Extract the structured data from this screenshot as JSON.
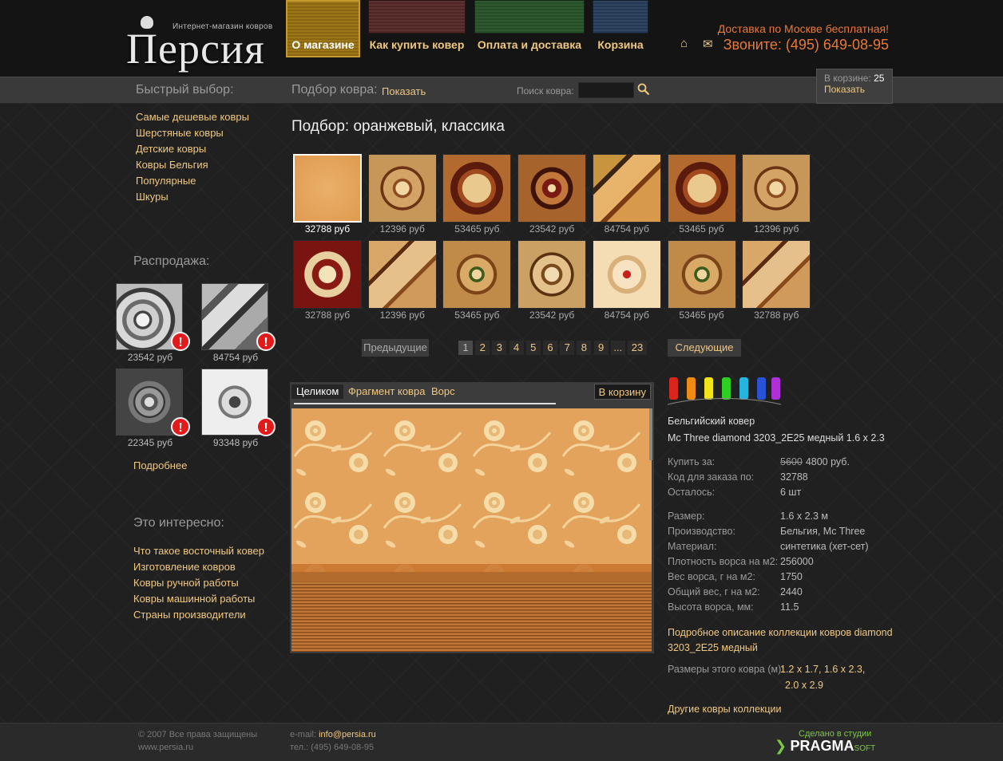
{
  "header": {
    "logo_word": "Персия",
    "logo_tag": "Интернет-магазин ковров",
    "nav": [
      {
        "label": "О магазине",
        "color": "#8a6612"
      },
      {
        "label": "Как купить ковер",
        "color": "#5a2c2c"
      },
      {
        "label": "Оплата и доставка",
        "color": "#2f5a30"
      },
      {
        "label": "Корзина",
        "color": "#2e4460"
      }
    ],
    "home_icon": "⌂",
    "map_icon": "✉",
    "delivery": "Доставка по Москве бесплатная!",
    "phone": "Звоните: (495) 649-08-95"
  },
  "bar": {
    "quick_title": "Быстрый выбор:",
    "selection_title": "Подбор ковра:",
    "selection_link": "Показать",
    "search_label": "Поиск ковра:",
    "search_value": "",
    "cart_label": "В корзине:",
    "cart_count": "25",
    "cart_show": "Показать"
  },
  "quick_links": [
    "Самые дешевые ковры",
    "Шерстяные ковры",
    "Детские ковры",
    "Ковры Бельгия",
    "Популярные",
    "Шкуры"
  ],
  "sale": {
    "title": "Распродажа:",
    "items": [
      {
        "price": "23542 руб"
      },
      {
        "price": "84754 руб"
      },
      {
        "price": "22345 руб"
      },
      {
        "price": "93348 руб"
      }
    ],
    "more": "Подробнее"
  },
  "interest": {
    "title": "Это интересно:",
    "links": [
      "Что такое восточный ковер",
      "Изготовление ковров",
      "Ковры ручной работы",
      "Ковры машинной работы",
      "Страны производители"
    ]
  },
  "main": {
    "title": "Подбор: оранжевый, классика",
    "thumbs": [
      {
        "price": "32788 руб"
      },
      {
        "price": "12396 руб"
      },
      {
        "price": "53465 руб"
      },
      {
        "price": "23542 руб"
      },
      {
        "price": "84754 руб"
      },
      {
        "price": "53465 руб"
      },
      {
        "price": "12396 руб"
      },
      {
        "price": "32788 руб"
      },
      {
        "price": "12396 руб"
      },
      {
        "price": "53465 руб"
      },
      {
        "price": "23542 руб"
      },
      {
        "price": "84754 руб"
      },
      {
        "price": "53465 руб"
      },
      {
        "price": "32788 руб"
      }
    ],
    "pager": {
      "prev": "Предыдущие",
      "next": "Следующие",
      "pages": [
        "1",
        "2",
        "3",
        "4",
        "5",
        "6",
        "7",
        "8",
        "9",
        "...",
        "23"
      ],
      "current": "1"
    }
  },
  "viewer": {
    "tabs": [
      "Целиком",
      "Фрагмент ковра",
      "Ворс"
    ],
    "to_basket": "В корзину"
  },
  "product": {
    "type": "Бельгийский ковер",
    "name": "Mc Three diamond 3203_2E25 медный 1.6 x 2.3",
    "buy_label": "Купить за:",
    "old_price": "5600",
    "price": "4800 руб.",
    "code_label": "Код для заказа по:",
    "code": "32788",
    "left_label": "Осталось:",
    "left": "6 шт",
    "specs": [
      {
        "k": "Размер:",
        "v": "1.6 x 2.3 м"
      },
      {
        "k": "Производство:",
        "v": "Бельгия, Mc Three"
      },
      {
        "k": "Материал:",
        "v": "синтетика (хет-сет)"
      },
      {
        "k": "Плотность ворса на м2:",
        "v": "256000"
      },
      {
        "k": "Вес ворса, г на м2:",
        "v": "1750"
      },
      {
        "k": "Общий вес, г на м2:",
        "v": "2440"
      },
      {
        "k": "Высота ворса, мм:",
        "v": "11.5"
      }
    ],
    "collection_link_1": "Подробное описание коллекции ковров diamond",
    "collection_link_2": "3203_2E25 медный",
    "sizes_label": "Размеры этого ковра (м):",
    "sizes_1": "1.2 x 1.7, 1.6 x 2.3,",
    "sizes_2": "2.0 x 2.9",
    "other_link": "Другие ковры коллекции"
  },
  "footer": {
    "copy1": "© 2007 Все права защищены",
    "copy2": "www.persia.ru",
    "email_label": "e-mail:",
    "email": "info@persia.ru",
    "phone": "тел.: (495) 649-08-95",
    "studio": "Сделано в студии",
    "studio_name": "PRAGMA",
    "studio_suffix": "SOFT"
  }
}
